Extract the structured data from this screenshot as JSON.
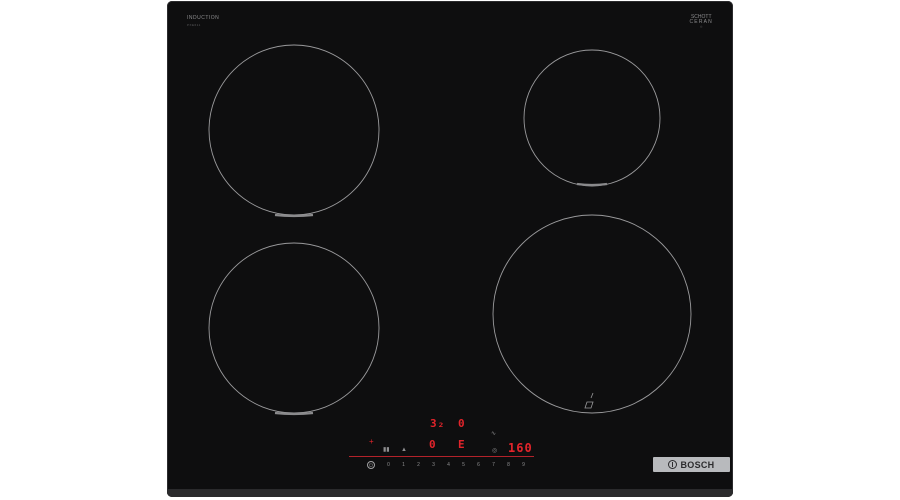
{
  "product": {
    "type_label": "INDUCTION",
    "type_sublabel": "PXE611",
    "glass_brand_line1": "SCHOTT",
    "glass_brand_line2": "CERAN",
    "glass_brand_sub": "®"
  },
  "display": {
    "timer_top_left": "3₂",
    "timer_top_right": "0",
    "timer_bottom_left": "0",
    "timer_bottom_right": "E",
    "temperature": "160"
  },
  "power_scale": [
    "0",
    "1",
    "2",
    "3",
    "4",
    "5",
    "6",
    "7",
    "8",
    "9"
  ],
  "power_button_symbol": "⏻",
  "badge": {
    "brand": "BOSCH"
  },
  "colors": {
    "glass": "#0e0e0f",
    "ring": "#9a9a9c",
    "display_red": "#e3242b",
    "badge_bg": "#b8babd"
  },
  "icons": {
    "zone_left_marker": "arc-marker-icon",
    "frying_sensor": "pan-sensor-icon",
    "power": "power-icon",
    "child_lock": "lock-icon",
    "timer": "timer-icon"
  }
}
